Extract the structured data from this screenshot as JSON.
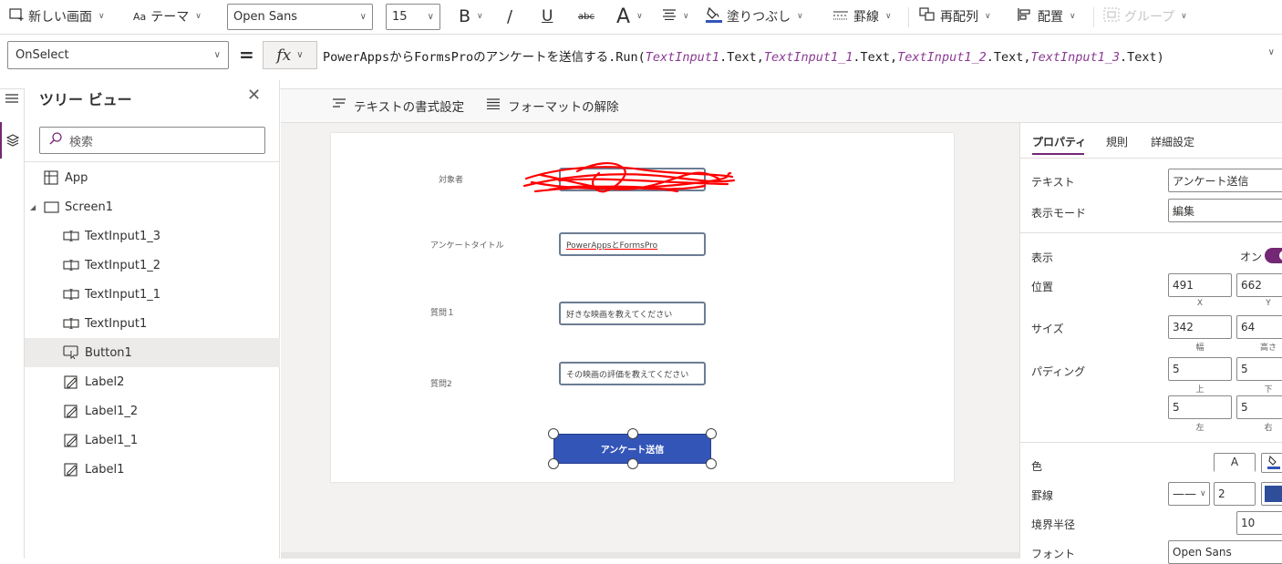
{
  "toolbar": {
    "new_screen": "新しい画面",
    "theme": "テーマ",
    "font_family": "Open Sans",
    "font_size": "15",
    "bold": "B",
    "italic": "/",
    "underline": "U",
    "strike": "abc",
    "font_color": "A",
    "fill": "塗りつぶし",
    "border": "罫線",
    "reorder": "再配列",
    "align": "配置",
    "group": "グループ"
  },
  "formula": {
    "property": "OnSelect",
    "equals": "=",
    "fx": "fx",
    "fn": "PowerAppsからFormsProのアンケートを送信する.Run(",
    "arg1": "TextInput1",
    "arg1_tail": ".Text,",
    "arg2": "TextInput1_1",
    "arg2_tail": ".Text,",
    "arg3": "TextInput1_2",
    "arg3_tail": ".Text,",
    "arg4": "TextInput1_3",
    "arg4_tail": ".Text)"
  },
  "text_toolbar": {
    "format_text": "テキストの書式設定",
    "remove_format": "フォーマットの解除"
  },
  "tree": {
    "title": "ツリー ビュー",
    "search_placeholder": "検索",
    "items": [
      {
        "label": "App",
        "icon": "app-icon"
      },
      {
        "label": "Screen1",
        "icon": "screen-icon"
      },
      {
        "label": "TextInput1_3",
        "icon": "text-input-icon"
      },
      {
        "label": "TextInput1_2",
        "icon": "text-input-icon"
      },
      {
        "label": "TextInput1_1",
        "icon": "text-input-icon"
      },
      {
        "label": "TextInput1",
        "icon": "text-input-icon"
      },
      {
        "label": "Button1",
        "icon": "button-icon"
      },
      {
        "label": "Label2",
        "icon": "label-icon"
      },
      {
        "label": "Label1_2",
        "icon": "label-icon"
      },
      {
        "label": "Label1_1",
        "icon": "label-icon"
      },
      {
        "label": "Label1",
        "icon": "label-icon"
      }
    ]
  },
  "canvas": {
    "label_target": "対象者",
    "label_title": "アンケートタイトル",
    "label_q1": "質問１",
    "label_q2": "質問2",
    "input_title": "PowerAppsとFormsPro",
    "input_q1": "好きな映画を教えてください",
    "input_q2": "その映画の評価を教えてください",
    "button": "アンケート送信",
    "redaction_color": "#ff0000"
  },
  "props": {
    "tabs": [
      "プロパティ",
      "規則",
      "詳細設定"
    ],
    "text_label": "テキスト",
    "text_value": "アンケート送信",
    "display_mode_label": "表示モード",
    "display_mode_value": "編集",
    "visible_label": "表示",
    "visible_value": "オン",
    "position_label": "位置",
    "pos_x": "491",
    "pos_y": "662",
    "x_label": "X",
    "y_label": "Y",
    "size_label": "サイズ",
    "width": "342",
    "height": "64",
    "width_label": "幅",
    "height_label": "高さ",
    "padding_label": "パディング",
    "pad_top": "5",
    "pad_bottom": "5",
    "pad_left": "5",
    "pad_right": "5",
    "top_label": "上",
    "bottom_label": "下",
    "left_label": "左",
    "right_label": "右",
    "color_label": "色",
    "color_a": "A",
    "border_label": "罫線",
    "border_width": "2",
    "radius_label": "境界半径",
    "radius_value": "10",
    "font_label": "フォント",
    "font_value": "Open Sans",
    "accent_color": "#742774",
    "button_color": "#3355b8"
  }
}
